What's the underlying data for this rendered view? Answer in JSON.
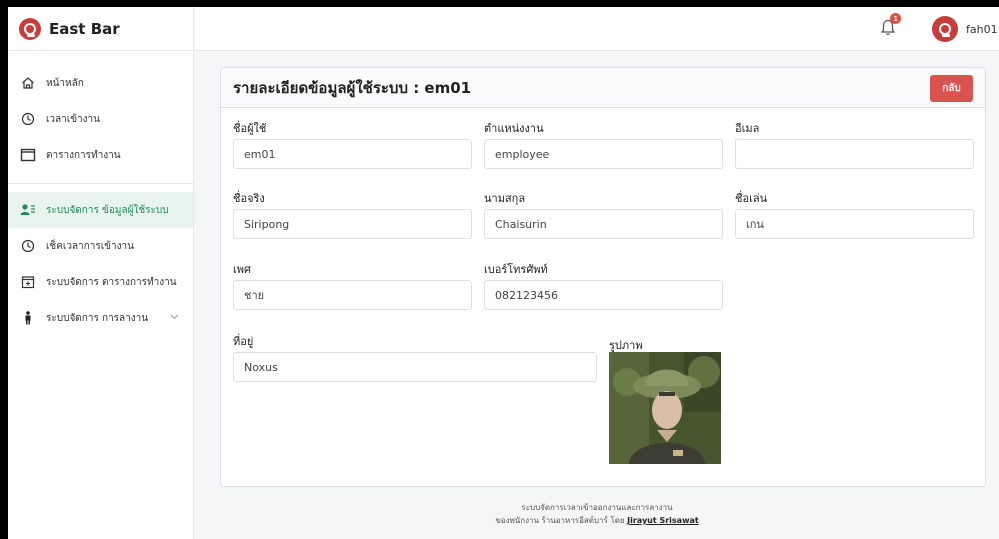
{
  "brand": {
    "name": "East Bar",
    "accent": "#c83c3c"
  },
  "sidebar": {
    "items": [
      {
        "label": "หน้าหลัก",
        "icon": "home-icon"
      },
      {
        "label": "เวลาเข้างาน",
        "icon": "clock-icon"
      },
      {
        "label": "ตารางการทำงาน",
        "icon": "calendar-icon"
      },
      {
        "label": "ระบบจัดการ ข้อมูลผู้ใช้ระบบ",
        "icon": "users-icon",
        "active": true
      },
      {
        "label": "เช็คเวลาการเข้างาน",
        "icon": "clock-icon"
      },
      {
        "label": "ระบบจัดการ ตารางการทำงาน",
        "icon": "calendar-plus-icon"
      },
      {
        "label": "ระบบจัดการ การลางาน",
        "icon": "person-icon",
        "expandable": true
      }
    ],
    "active_color": "#1e8a5a"
  },
  "topbar": {
    "notification_count": "1",
    "username": "fah01"
  },
  "card": {
    "title": "รายละเอียดข้อมูลผู้ใช้ระบบ : em01",
    "back_label": "กลับ",
    "fields": {
      "username": {
        "label": "ชื่อผู้ใช้",
        "value": "em01"
      },
      "position": {
        "label": "ตำแหน่งงาน",
        "value": "employee"
      },
      "email": {
        "label": "อีเมล",
        "value": ""
      },
      "firstname": {
        "label": "ชื่อจริง",
        "value": "Siripong"
      },
      "lastname": {
        "label": "นามสกุล",
        "value": "Chaisurin"
      },
      "nickname": {
        "label": "ชื่อเล่น",
        "value": "เกน"
      },
      "gender": {
        "label": "เพศ",
        "value": "ชาย"
      },
      "phone": {
        "label": "เบอร์โทรศัพท์",
        "value": "082123456"
      },
      "address": {
        "label": "ที่อยู่",
        "value": "Noxus"
      }
    },
    "photo_label": "รูปภาพ"
  },
  "footer": {
    "line1": "ระบบจัดการเวลาเข้าออกงานและการลางาน",
    "line2_prefix": "ของพนักงาน ร้านอาหารอีสต์บาร์ โดย",
    "author": "Jirayut Srisawat"
  }
}
